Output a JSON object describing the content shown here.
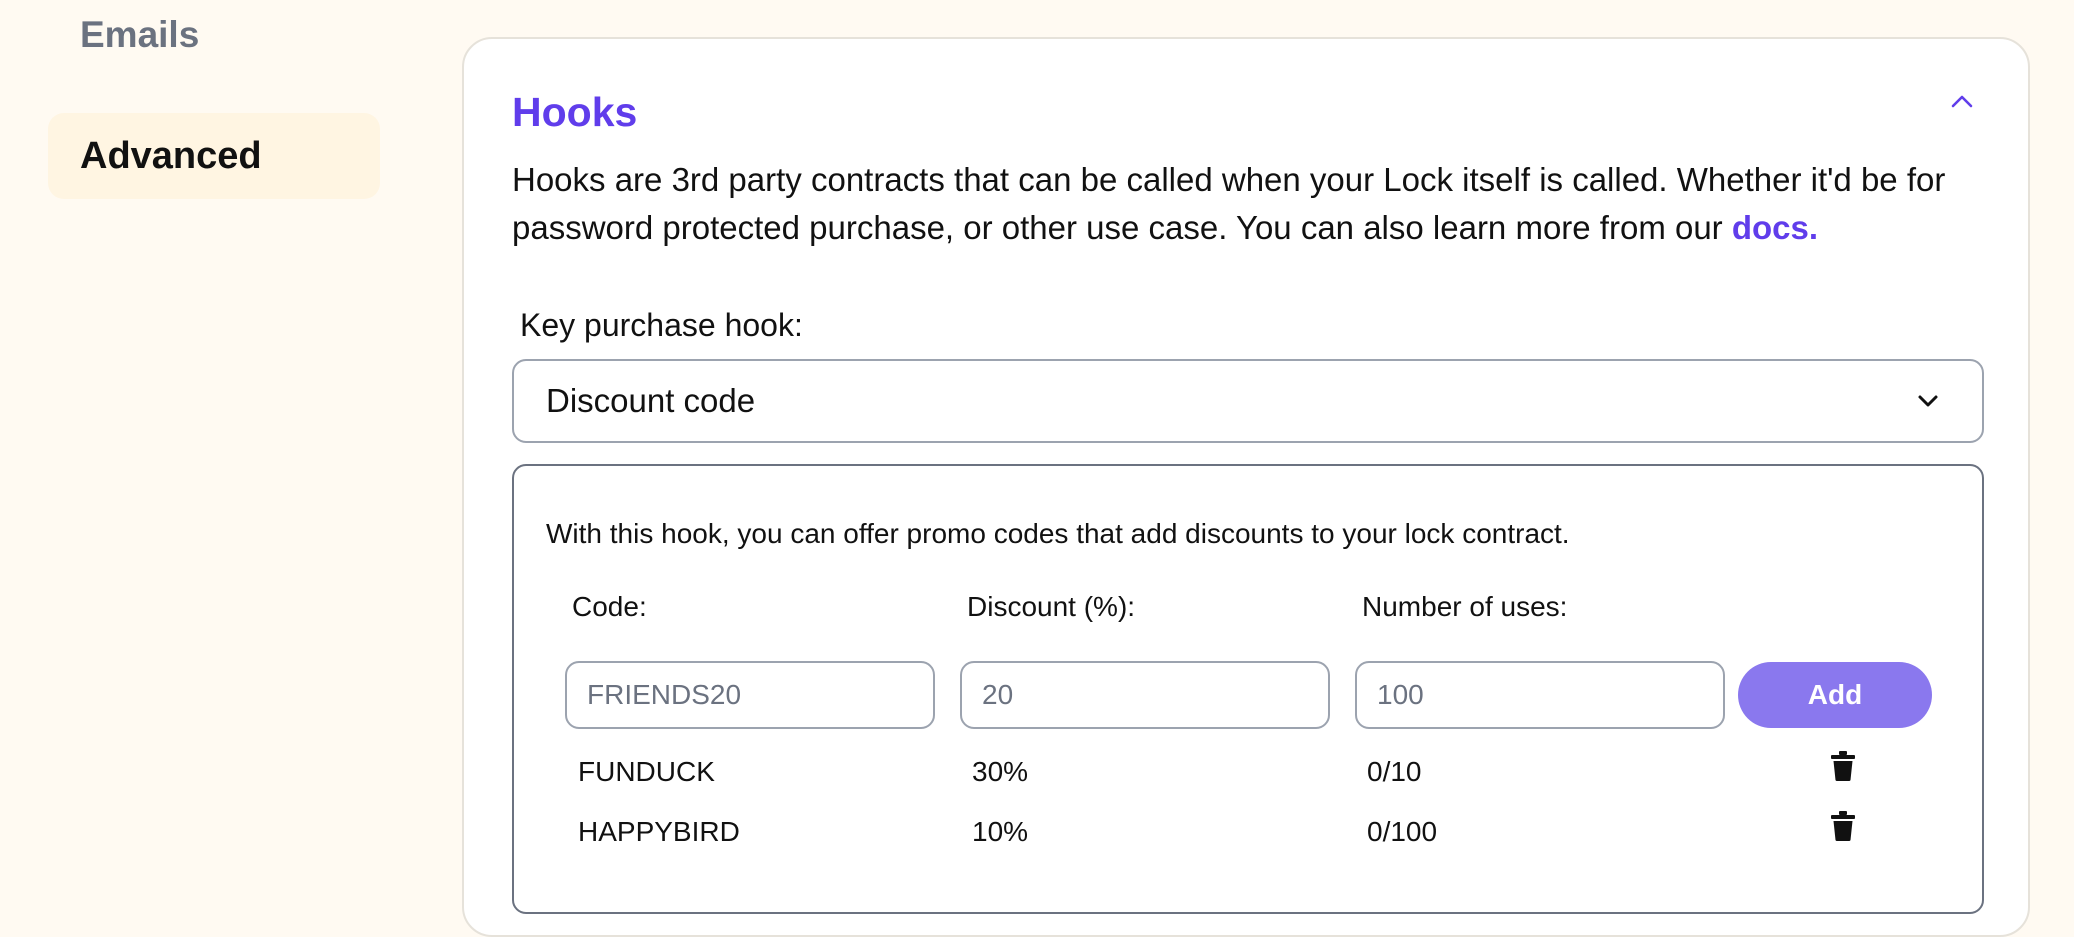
{
  "sidebar": {
    "items": [
      {
        "label": "Emails"
      },
      {
        "label": "Advanced",
        "active": true
      }
    ]
  },
  "hooks": {
    "title": "Hooks",
    "description_text": "Hooks are 3rd party contracts that can be called when your Lock itself is called. Whether it'd be for password protected purchase, or other use case. You can also learn more from our ",
    "docs_link": "docs.",
    "collapse_icon": "chevron-up-icon",
    "key_purchase_label": "Key purchase hook:",
    "selected_hook": "Discount code",
    "discount": {
      "description": "With this hook, you can offer promo codes that add discounts to your lock contract.",
      "code_label": "Code:",
      "discount_label": "Discount (%):",
      "uses_label": "Number of uses:",
      "code_placeholder": "FRIENDS20",
      "discount_placeholder": "20",
      "uses_placeholder": "100",
      "add_label": "Add",
      "codes": [
        {
          "code": "FUNDUCK",
          "discount": "30%",
          "uses": "0/10"
        },
        {
          "code": "HAPPYBIRD",
          "discount": "10%",
          "uses": "0/100"
        }
      ]
    }
  },
  "colors": {
    "accent": "#603deb",
    "button": "#8a78ee",
    "page_bg": "#fffaf2",
    "active_nav_bg": "#fff5e2"
  }
}
